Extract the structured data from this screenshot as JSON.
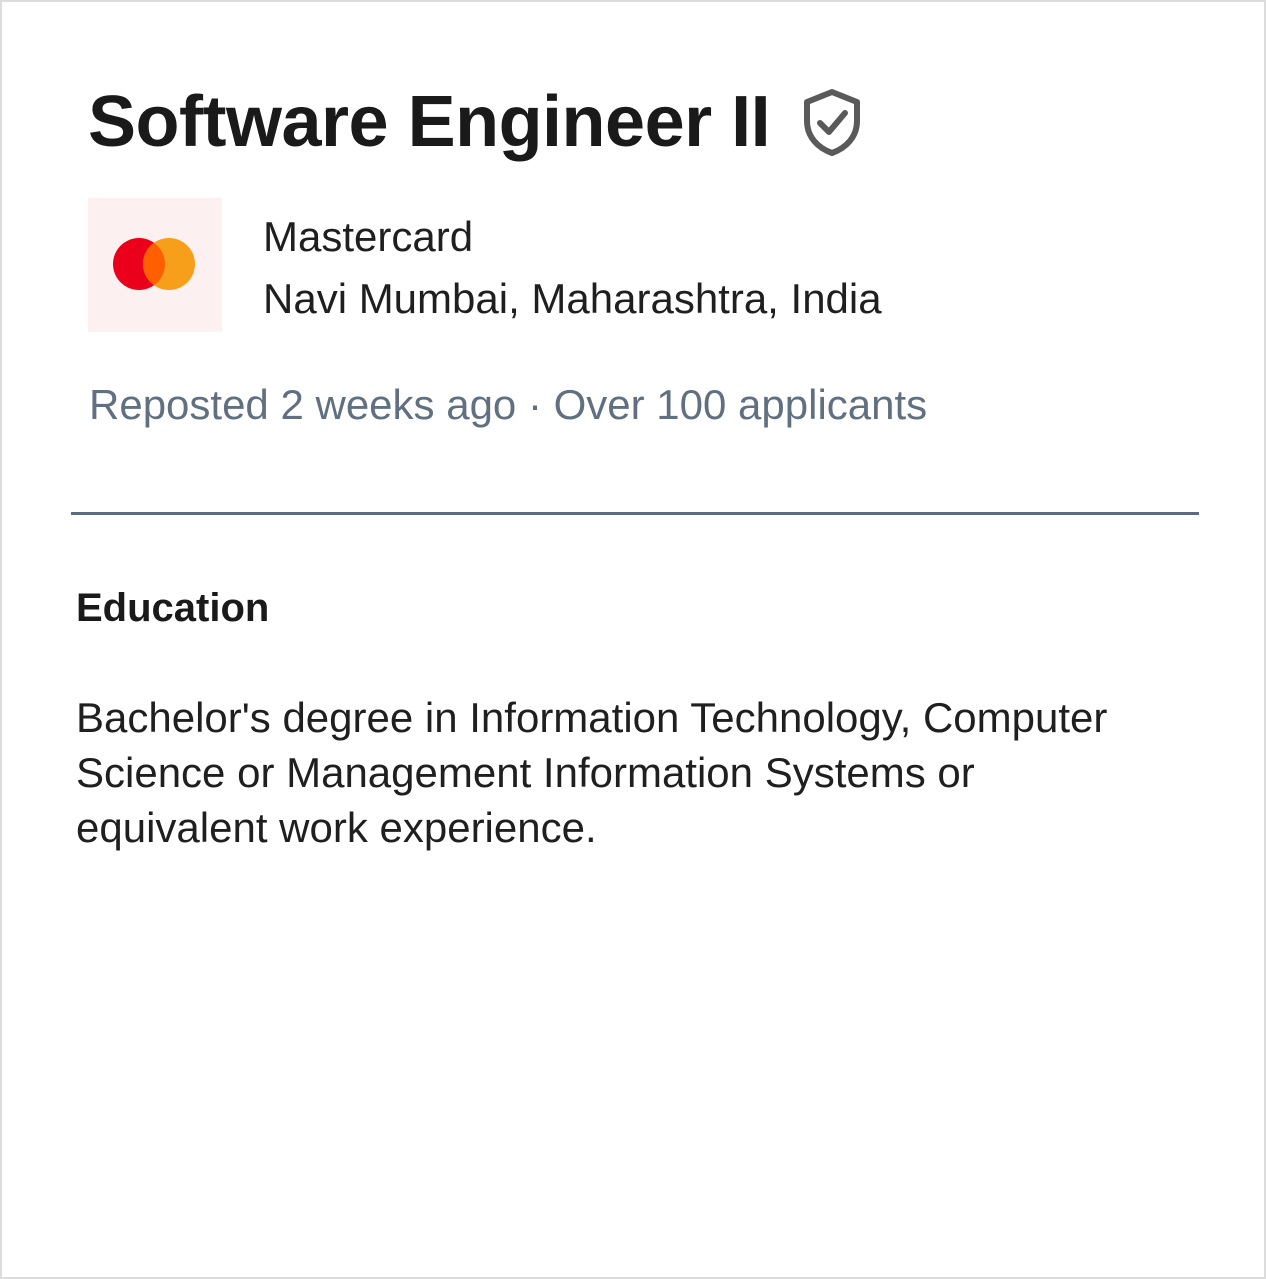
{
  "job": {
    "title": "Software Engineer II",
    "verified_icon": "shield-check-icon",
    "company": "Mastercard",
    "location": "Navi Mumbai, Maharashtra, India",
    "posted": "Reposted 2 weeks ago",
    "separator": " · ",
    "applicants": "Over 100 applicants"
  },
  "logo": {
    "icon": "mastercard-logo",
    "red": "#eb001b",
    "orange": "#f79e1b",
    "overlap": "#ff5f00",
    "background": "#fdf0f0"
  },
  "education": {
    "heading": "Education",
    "body": "Bachelor's degree in Information Technology, Computer Science or Management Information Systems or equivalent work experience."
  },
  "colors": {
    "title": "#1a1a1a",
    "meta": "#617080",
    "divider": "#5b6b80",
    "icon": "#5a5a5a"
  }
}
